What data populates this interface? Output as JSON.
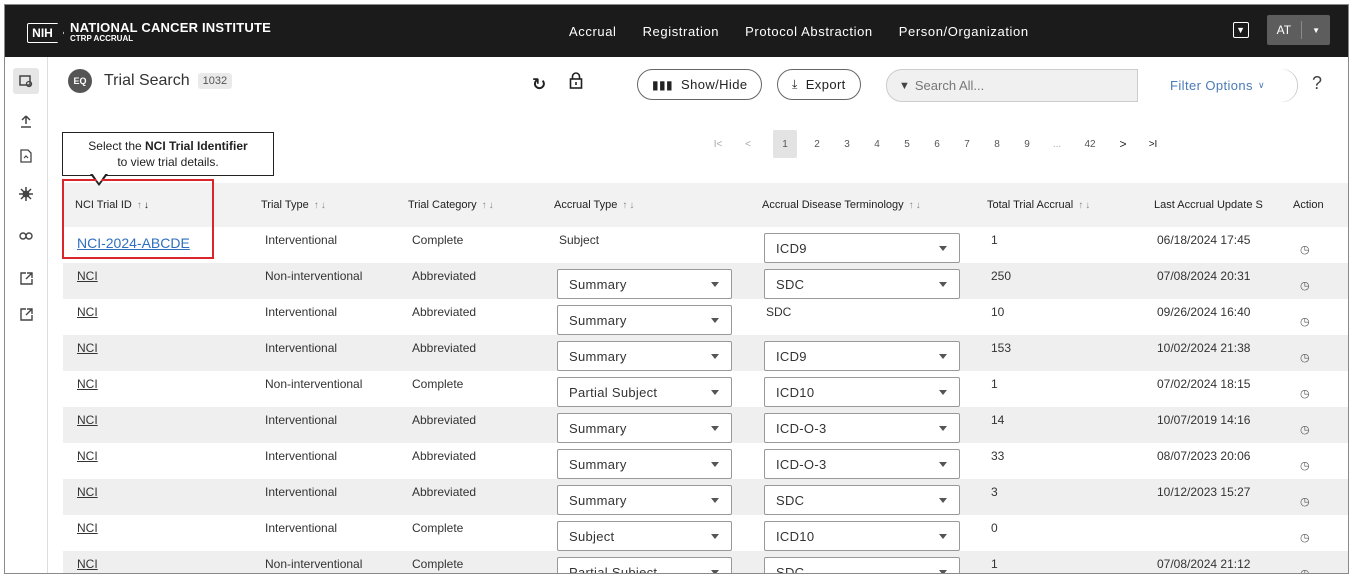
{
  "header": {
    "logo_abbr": "NIH",
    "logo_line1": "NATIONAL CANCER INSTITUTE",
    "logo_line2": "CTRP ACCRUAL",
    "nav": [
      "Accrual",
      "Registration",
      "Protocol Abstraction",
      "Person/Organization"
    ],
    "user_initials": "AT"
  },
  "toolbar": {
    "title": "Trial Search",
    "count": "1032",
    "show_hide_label": "Show/Hide",
    "export_label": "Export",
    "search_placeholder": "Search All...",
    "filter_label": "Filter Options",
    "help": "?"
  },
  "pagination": {
    "first": "I<",
    "prev": "<",
    "pages": [
      "1",
      "2",
      "3",
      "4",
      "5",
      "6",
      "7",
      "8",
      "9"
    ],
    "ellipsis": "...",
    "last_page": "42",
    "next": ">",
    "last": ">I",
    "current": "1"
  },
  "callout": {
    "prefix": "Select the ",
    "bold": "NCI Trial Identifier",
    "suffix": "to view trial details."
  },
  "table": {
    "columns": [
      "NCI Trial ID",
      "Trial Type",
      "Trial Category",
      "Accrual Type",
      "Accrual Disease Terminology",
      "Total Trial Accrual",
      "Last Accrual Update S",
      "Action"
    ],
    "rows": [
      {
        "id": "NCI-2024-ABCDE",
        "type": "Interventional",
        "category": "Complete",
        "accrual_type": "Subject",
        "accrual_type_select": false,
        "terminology": "ICD9",
        "terminology_select": true,
        "total": "1",
        "updated": "06/18/2024 17:45"
      },
      {
        "id": "NCI",
        "type": "Non-interventional",
        "category": "Abbreviated",
        "accrual_type": "Summary",
        "accrual_type_select": true,
        "terminology": "SDC",
        "terminology_select": true,
        "total": "250",
        "updated": "07/08/2024 20:31"
      },
      {
        "id": "NCI",
        "type": "Interventional",
        "category": "Abbreviated",
        "accrual_type": "Summary",
        "accrual_type_select": true,
        "terminology": "SDC",
        "terminology_select": false,
        "total": "10",
        "updated": "09/26/2024 16:40"
      },
      {
        "id": "NCI",
        "type": "Interventional",
        "category": "Abbreviated",
        "accrual_type": "Summary",
        "accrual_type_select": true,
        "terminology": "ICD9",
        "terminology_select": true,
        "total": "153",
        "updated": "10/02/2024 21:38"
      },
      {
        "id": "NCI",
        "type": "Non-interventional",
        "category": "Complete",
        "accrual_type": "Partial Subject",
        "accrual_type_select": true,
        "terminology": "ICD10",
        "terminology_select": true,
        "total": "1",
        "updated": "07/02/2024 18:15"
      },
      {
        "id": "NCI",
        "type": "Interventional",
        "category": "Abbreviated",
        "accrual_type": "Summary",
        "accrual_type_select": true,
        "terminology": "ICD-O-3",
        "terminology_select": true,
        "total": "14",
        "updated": "10/07/2019 14:16"
      },
      {
        "id": "NCI",
        "type": "Interventional",
        "category": "Abbreviated",
        "accrual_type": "Summary",
        "accrual_type_select": true,
        "terminology": "ICD-O-3",
        "terminology_select": true,
        "total": "33",
        "updated": "08/07/2023 20:06"
      },
      {
        "id": "NCI",
        "type": "Interventional",
        "category": "Abbreviated",
        "accrual_type": "Summary",
        "accrual_type_select": true,
        "terminology": "SDC",
        "terminology_select": true,
        "total": "3",
        "updated": "10/12/2023 15:27"
      },
      {
        "id": "NCI",
        "type": "Interventional",
        "category": "Complete",
        "accrual_type": "Subject",
        "accrual_type_select": true,
        "terminology": "ICD10",
        "terminology_select": true,
        "total": "0",
        "updated": ""
      },
      {
        "id": "NCI",
        "type": "Non-interventional",
        "category": "Complete",
        "accrual_type": "Partial Subject",
        "accrual_type_select": true,
        "terminology": "SDC",
        "terminology_select": true,
        "total": "1",
        "updated": "07/08/2024 21:12"
      }
    ]
  },
  "colors": {
    "nav_bg": "#1b1b1b",
    "link_blue": "#2f6fbf",
    "highlight_red": "#d9262b",
    "filter_blue": "#4a7ab8"
  }
}
